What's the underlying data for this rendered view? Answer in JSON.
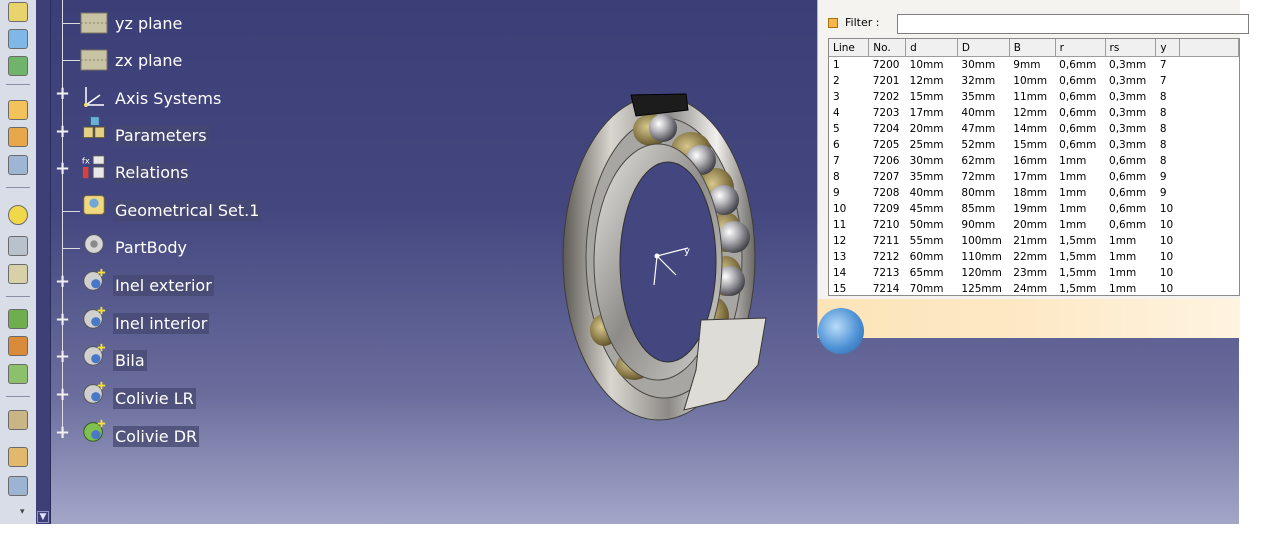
{
  "tree": {
    "items": [
      {
        "label": "yz plane",
        "icon": "plane-icon",
        "expandable": false
      },
      {
        "label": "zx plane",
        "icon": "plane-icon",
        "expandable": false
      },
      {
        "label": "Axis Systems",
        "icon": "axis-system-icon",
        "expandable": true
      },
      {
        "label": "Parameters",
        "icon": "parameters-icon",
        "expandable": true
      },
      {
        "label": "Relations",
        "icon": "relations-icon",
        "expandable": true
      },
      {
        "label": "Geometrical Set.1",
        "icon": "geometrical-set-icon",
        "expandable": false
      },
      {
        "label": "PartBody",
        "icon": "part-body-icon",
        "expandable": false
      },
      {
        "label": "Inel exterior",
        "icon": "body-icon",
        "expandable": true
      },
      {
        "label": "Inel interior",
        "icon": "body-icon",
        "expandable": true
      },
      {
        "label": "Bila",
        "icon": "body-icon",
        "expandable": true
      },
      {
        "label": "Colivie LR",
        "icon": "body-icon",
        "expandable": true
      },
      {
        "label": "Colivie DR",
        "icon": "body-active-icon",
        "expandable": true
      }
    ]
  },
  "design_table": {
    "filter_label": "Filter :",
    "filter_value": "",
    "columns": [
      "Line",
      "No.",
      "d",
      "D",
      "B",
      "r",
      "rs",
      "y"
    ],
    "rows": [
      [
        "1",
        "7200",
        "10mm",
        "30mm",
        "9mm",
        "0,6mm",
        "0,3mm",
        "7"
      ],
      [
        "2",
        "7201",
        "12mm",
        "32mm",
        "10mm",
        "0,6mm",
        "0,3mm",
        "7"
      ],
      [
        "3",
        "7202",
        "15mm",
        "35mm",
        "11mm",
        "0,6mm",
        "0,3mm",
        "8"
      ],
      [
        "4",
        "7203",
        "17mm",
        "40mm",
        "12mm",
        "0,6mm",
        "0,3mm",
        "8"
      ],
      [
        "5",
        "7204",
        "20mm",
        "47mm",
        "14mm",
        "0,6mm",
        "0,3mm",
        "8"
      ],
      [
        "6",
        "7205",
        "25mm",
        "52mm",
        "15mm",
        "0,6mm",
        "0,3mm",
        "8"
      ],
      [
        "7",
        "7206",
        "30mm",
        "62mm",
        "16mm",
        "1mm",
        "0,6mm",
        "8"
      ],
      [
        "8",
        "7207",
        "35mm",
        "72mm",
        "17mm",
        "1mm",
        "0,6mm",
        "9"
      ],
      [
        "9",
        "7208",
        "40mm",
        "80mm",
        "18mm",
        "1mm",
        "0,6mm",
        "9"
      ],
      [
        "10",
        "7209",
        "45mm",
        "85mm",
        "19mm",
        "1mm",
        "0,6mm",
        "10"
      ],
      [
        "11",
        "7210",
        "50mm",
        "90mm",
        "20mm",
        "1mm",
        "0,6mm",
        "10"
      ],
      [
        "12",
        "7211",
        "55mm",
        "100mm",
        "21mm",
        "1,5mm",
        "1mm",
        "10"
      ],
      [
        "13",
        "7212",
        "60mm",
        "110mm",
        "22mm",
        "1,5mm",
        "1mm",
        "10"
      ],
      [
        "14",
        "7213",
        "65mm",
        "120mm",
        "23mm",
        "1,5mm",
        "1mm",
        "10"
      ],
      [
        "15",
        "7214",
        "70mm",
        "125mm",
        "24mm",
        "1,5mm",
        "1mm",
        "10"
      ]
    ]
  },
  "axis_label": "y",
  "colors": {
    "viewport_top": "#3c3e77",
    "viewport_bottom": "#a3a6c8",
    "cage": "#8a7a48",
    "filter_icon": "#f6b64a"
  }
}
